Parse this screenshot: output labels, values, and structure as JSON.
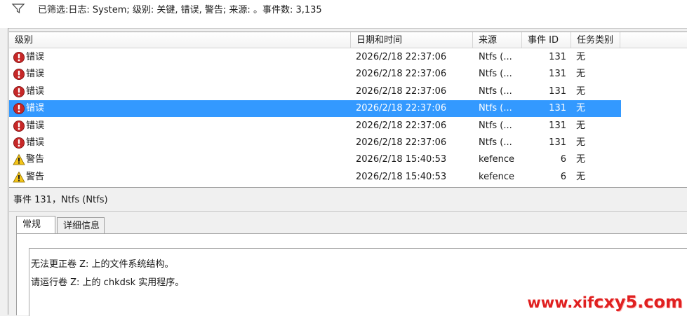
{
  "filter_bar": {
    "text": "已筛选:日志: System; 级别: 关键, 错误, 警告; 来源: 。事件数: 3,135"
  },
  "grid": {
    "headers": [
      "级别",
      "日期和时间",
      "来源",
      "事件 ID",
      "任务类别"
    ],
    "rows": [
      {
        "level": "错误",
        "icon": "error-icon",
        "date": "2026/2/18 22:37:06",
        "source": "Ntfs (...",
        "id": "131",
        "task": "无"
      },
      {
        "level": "错误",
        "icon": "error-icon",
        "date": "2026/2/18 22:37:06",
        "source": "Ntfs (...",
        "id": "131",
        "task": "无"
      },
      {
        "level": "错误",
        "icon": "error-icon",
        "date": "2026/2/18 22:37:06",
        "source": "Ntfs (...",
        "id": "131",
        "task": "无"
      },
      {
        "level": "错误",
        "icon": "error-icon",
        "date": "2026/2/18 22:37:06",
        "source": "Ntfs (...",
        "id": "131",
        "task": "无"
      },
      {
        "level": "错误",
        "icon": "error-icon",
        "date": "2026/2/18 22:37:06",
        "source": "Ntfs (...",
        "id": "131",
        "task": "无"
      },
      {
        "level": "错误",
        "icon": "error-icon",
        "date": "2026/2/18 22:37:06",
        "source": "Ntfs (...",
        "id": "131",
        "task": "无"
      },
      {
        "level": "警告",
        "icon": "warning-icon",
        "date": "2026/2/18 15:40:53",
        "source": "kefence",
        "id": "6",
        "task": "无"
      },
      {
        "level": "警告",
        "icon": "warning-icon",
        "date": "2026/2/18 15:40:53",
        "source": "kefence",
        "id": "6",
        "task": "无"
      }
    ],
    "selected_row": 3
  },
  "detail": {
    "title": "事件 131，Ntfs (Ntfs)",
    "tabs": [
      "常规",
      "详细信息"
    ],
    "active_tab": 0,
    "message_lines": [
      "无法更正卷 Z: 上的文件系统结构。",
      "请运行卷 Z: 上的 chkdsk 实用程序。"
    ]
  },
  "watermark": {
    "text_a": "www.xif",
    "text_b": "cxy5.com"
  },
  "colors": {
    "selection": "#3399ff",
    "error": "#c62828",
    "warning": "#f5c518"
  }
}
